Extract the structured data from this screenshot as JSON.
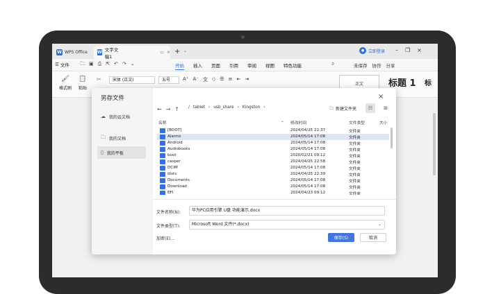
{
  "titlebar": {
    "app_name": "WPS Office",
    "doc_tab": "文字文稿1",
    "login": "立即登录"
  },
  "menubar": {
    "file": "文件",
    "menus": [
      "开始",
      "插入",
      "页面",
      "引用",
      "审阅",
      "视图",
      "特色功能"
    ],
    "active_menu": "开始",
    "right": [
      "未保存",
      "协作",
      "分享"
    ]
  },
  "ribbon": {
    "format_painter": "格式刷",
    "paste": "粘贴",
    "font_name": "宋体 (正文)",
    "font_size": "五号",
    "style_preview": "正文",
    "heading1": "标题 1",
    "heading2": "标"
  },
  "dialog": {
    "title": "另存文件",
    "sidebar": [
      "我的云文档",
      "我的文档",
      "我的平板"
    ],
    "breadcrumb": [
      "/",
      "tablet",
      "usb_share",
      "Kingston"
    ],
    "new_folder": "新建文件夹",
    "columns": {
      "name": "名称",
      "modified": "修改时间",
      "type": "文件类型",
      "size": "大小"
    },
    "files": [
      {
        "name": "[BOOT]",
        "modified": "2024/04/25 22:37",
        "type": "文件夹"
      },
      {
        "name": "Alarms",
        "modified": "2024/05/14 17:08",
        "type": "文件夹"
      },
      {
        "name": "Android",
        "modified": "2024/05/14 17:08",
        "type": "文件夹"
      },
      {
        "name": "Audiobooks",
        "modified": "2024/05/14 17:08",
        "type": "文件夹"
      },
      {
        "name": "boot",
        "modified": "2020/02/21 09:12",
        "type": "文件夹"
      },
      {
        "name": "casper",
        "modified": "2024/04/25 22:58",
        "type": "文件夹"
      },
      {
        "name": "DCIM",
        "modified": "2024/05/14 17:08",
        "type": "文件夹"
      },
      {
        "name": "dists",
        "modified": "2024/04/25 22:39",
        "type": "文件夹"
      },
      {
        "name": "Documents",
        "modified": "2024/05/14 17:08",
        "type": "文件夹"
      },
      {
        "name": "Download",
        "modified": "2024/05/14 17:08",
        "type": "文件夹"
      },
      {
        "name": "EFI",
        "modified": "2024/04/23 09:12",
        "type": "文件夹"
      }
    ],
    "filename_label": "文件名称(N):",
    "filename_value": "华为PC应用引擎 U盘 功能演示.docx",
    "filetype_label": "文件类型(T):",
    "filetype_value": "Microsoft Word 文件(*.docx)",
    "encrypt": "加密(E)...",
    "save": "保存(S)",
    "cancel": "取消"
  }
}
